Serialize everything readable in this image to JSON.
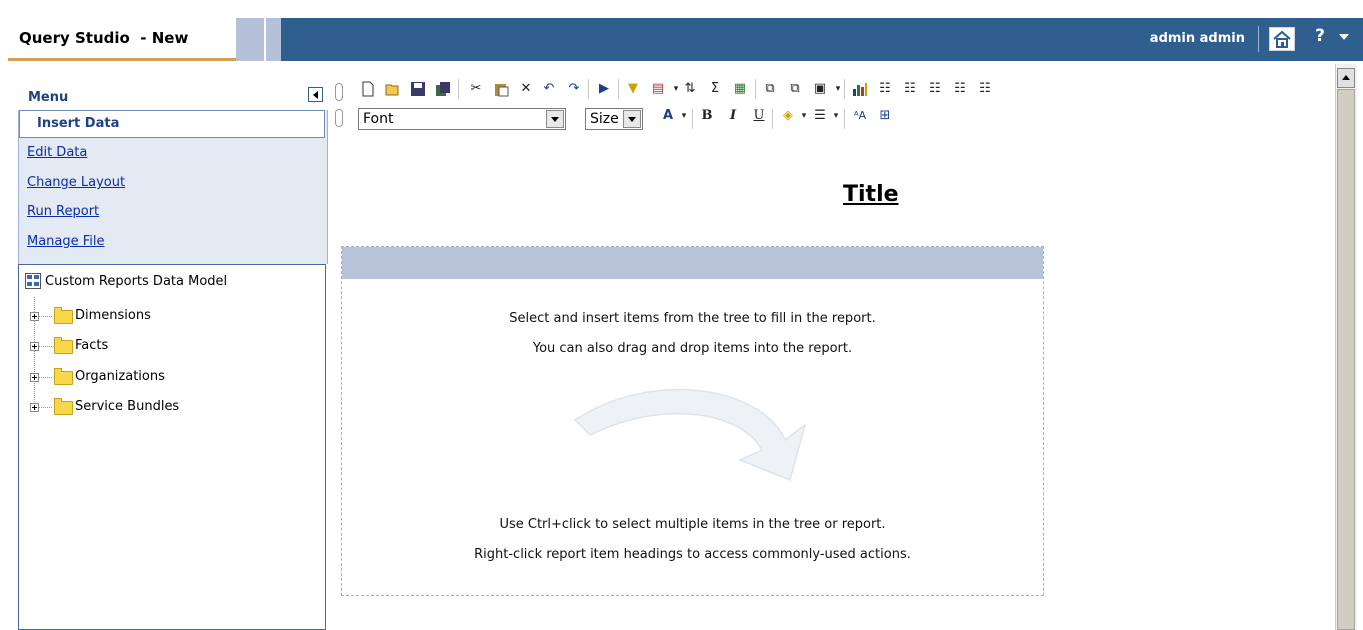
{
  "app": {
    "name": "Query Studio  - New",
    "user": "admin admin"
  },
  "menu": {
    "heading": "Menu",
    "items": [
      {
        "label": "Insert Data",
        "selected": true
      },
      {
        "label": "Edit Data"
      },
      {
        "label": "Change Layout"
      },
      {
        "label": "Run Report"
      },
      {
        "label": "Manage File"
      }
    ]
  },
  "tree": {
    "root": "Custom Reports Data Model",
    "folders": [
      "Dimensions",
      "Facts",
      "Organizations",
      "Service Bundles"
    ]
  },
  "formatting": {
    "font_value": "Font",
    "size_value": "Size"
  },
  "report": {
    "title": "Title",
    "hint_line1": "Select and insert items from the tree to fill in the report.",
    "hint_line2": "You can also drag and drop items into the report.",
    "hint_line3": "Use Ctrl+click to select multiple items in the tree or report.",
    "hint_line4": "Right-click report item headings to access commonly-used actions."
  },
  "colors": {
    "header_blue": "#2f5f8f",
    "tab_accent": "#d4a054",
    "menu_bg": "#e4eaf3",
    "drop_header": "#b7c3d9"
  }
}
